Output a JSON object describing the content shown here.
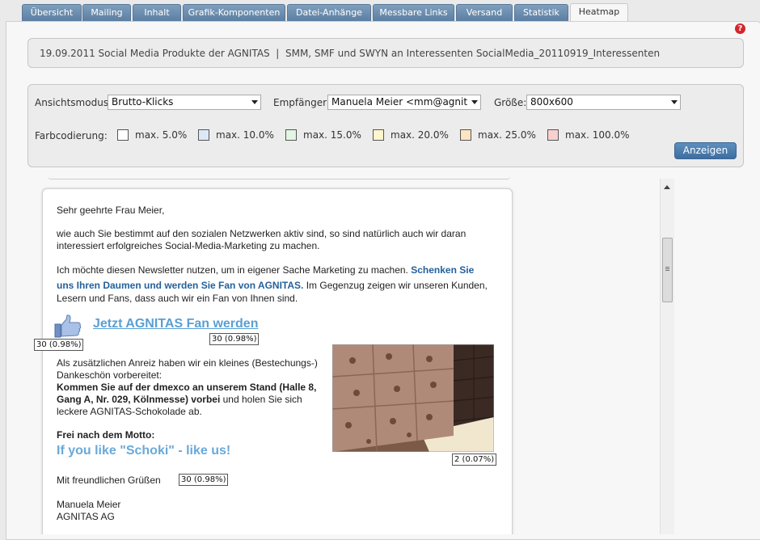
{
  "tabs": [
    {
      "label": "Übersicht"
    },
    {
      "label": "Mailing"
    },
    {
      "label": "Inhalt"
    },
    {
      "label": "Grafik-Komponenten"
    },
    {
      "label": "Datei-Anhänge"
    },
    {
      "label": "Messbare Links"
    },
    {
      "label": "Versand"
    },
    {
      "label": "Statistik"
    },
    {
      "label": "Heatmap"
    }
  ],
  "active_tab": "Heatmap",
  "help_icon": "?",
  "info": {
    "text": "19.09.2011 Social Media Produkte der AGNITAS  |  SMM, SMF und SWYN an Interessenten SocialMedia_20110919_Interessenten"
  },
  "filter": {
    "view_mode_label": "Ansichtsmodus:",
    "view_mode_value": "Brutto-Klicks",
    "recipient_label": "Empfänger:",
    "recipient_value": "Manuela Meier <mm@agnitas.de>",
    "size_label": "Größe:",
    "size_value": "800x600",
    "color_coding_label": "Farbcodierung:",
    "legend": [
      {
        "label": "max. 5.0%",
        "color": "#ffffff"
      },
      {
        "label": "max. 10.0%",
        "color": "#dde8f7"
      },
      {
        "label": "max. 15.0%",
        "color": "#e3f5e3"
      },
      {
        "label": "max. 20.0%",
        "color": "#fff6cf"
      },
      {
        "label": "max. 25.0%",
        "color": "#fde4c3"
      },
      {
        "label": "max. 100.0%",
        "color": "#f8d0d0"
      }
    ],
    "show_button": "Anzeigen"
  },
  "mail": {
    "salutation": "Sehr geehrte Frau Meier,",
    "para1_line1": "wie auch Sie bestimmt auf den sozialen Netzwerken aktiv sind, so sind natürlich auch wir daran",
    "para1_line2": "interessiert erfolgreiches Social-Media-Marketing zu machen.",
    "para2_line1_text": "Ich möchte diesen Newsletter nutzen, um in eigener Sache Marketing zu machen. ",
    "para2_line1_link": "Schenken Sie",
    "para2_line2_link": "uns Ihren Daumen und werden Sie Fan von AGNITAS.",
    "para2_line2_text": " Im Gegenzug zeigen wir unseren Kunden,",
    "para2_line3": "Lesern und Fans, dass auch wir ein Fan von Ihnen sind.",
    "fan_link": "Jetzt AGNITAS Fan werden",
    "para3_line1": "Als zusätzlichen Anreiz haben wir ein kleines (Bestechungs-)",
    "para3_line2": "Dankeschön vorbereitet:",
    "para3_line3_bold": "Kommen Sie auf der dmexco an unserem Stand (Halle 8,",
    "para3_line4_bold": "Gang A, Nr. 029, Kölnmesse) vorbei",
    "para3_line4_text": " und holen Sie sich",
    "para3_line5": "leckere AGNITAS-Schokolade ab.",
    "motto_label": "Frei nach dem Motto:",
    "motto": "If you like \"Schoki\" - like us!",
    "greeting": "Mit freundlichen Grüßen",
    "sig_name": "Manuela Meier",
    "sig_company": "AGNITAS AG"
  },
  "heatmap_labels": {
    "thumb": "30 (0.98%)",
    "fan_link": "30 (0.98%)",
    "chocolate": "2 (0.07%)",
    "greeting": "30 (0.98%)"
  }
}
